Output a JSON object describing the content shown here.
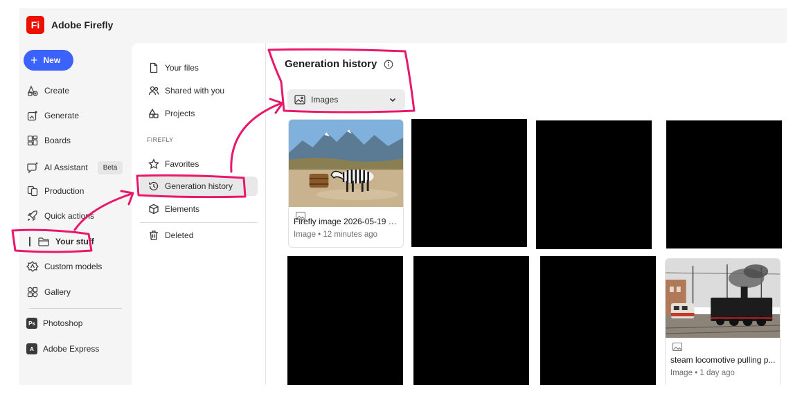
{
  "app": {
    "title": "Adobe Firefly",
    "logo_text": "Fi",
    "brand_color": "#eb1000"
  },
  "primary_nav": {
    "new_label": "New",
    "items": [
      {
        "label": "Create",
        "icon": "create-icon"
      },
      {
        "label": "Generate",
        "icon": "generate-icon"
      },
      {
        "label": "Boards",
        "icon": "boards-icon"
      },
      {
        "label": "AI Assistant",
        "icon": "ai-assistant-icon",
        "badge": "Beta"
      },
      {
        "label": "Production",
        "icon": "production-icon"
      },
      {
        "label": "Quick actions",
        "icon": "rocket-icon"
      },
      {
        "label": "Your stuff",
        "icon": "folder-icon",
        "selected": true
      },
      {
        "label": "Custom models",
        "icon": "custom-models-icon"
      },
      {
        "label": "Gallery",
        "icon": "gallery-icon"
      }
    ],
    "apps": [
      {
        "label": "Photoshop",
        "icon_text": "Ps"
      },
      {
        "label": "Adobe Express",
        "icon_text": "A"
      }
    ]
  },
  "secondary_nav": {
    "items_top": [
      {
        "label": "Your files",
        "icon": "file-icon"
      },
      {
        "label": "Shared with you",
        "icon": "shared-icon"
      },
      {
        "label": "Projects",
        "icon": "projects-icon"
      }
    ],
    "section_label": "FIREFLY",
    "items_firefly": [
      {
        "label": "Favorites",
        "icon": "star-icon"
      },
      {
        "label": "Generation history",
        "icon": "history-icon",
        "active": true
      },
      {
        "label": "Elements",
        "icon": "cube-icon"
      }
    ],
    "items_bottom": [
      {
        "label": "Deleted",
        "icon": "trash-icon"
      }
    ]
  },
  "content": {
    "title": "Generation history",
    "filter": {
      "selected": "Images"
    },
    "cards": [
      {
        "name": "Firefly image 2026-05-19 21...",
        "meta": "Image • 12 minutes ago",
        "thumb": "zebra-landscape"
      },
      {
        "name": "steam locomotive pulling p...",
        "meta": "Image • 1 day ago",
        "thumb": "steam-locomotive"
      }
    ]
  },
  "colors": {
    "accent": "#3b63fb",
    "annotation": "#e8196b"
  }
}
